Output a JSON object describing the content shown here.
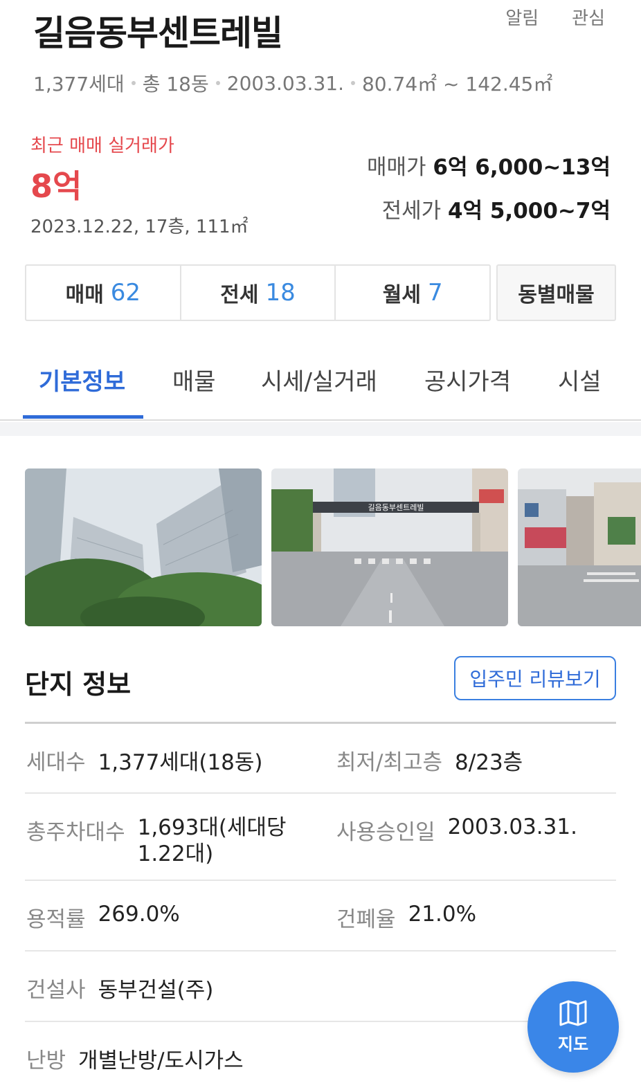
{
  "header": {
    "title": "길음동부센트레빌",
    "actions": [
      "알림",
      "관심"
    ],
    "summary": [
      "1,377세대",
      "총 18동",
      "2003.03.31.",
      "80.74㎡ ~ 142.45㎡"
    ]
  },
  "recent_deal": {
    "label": "최근 매매 실거래가",
    "price": "8억",
    "meta": "2023.12.22, 17층, 111㎡"
  },
  "price_ranges": {
    "sale_label": "매매가",
    "sale_value": "6억 6,000~13억",
    "jeonse_label": "전세가",
    "jeonse_value": "4억 5,000~7억"
  },
  "deal_tabs": [
    {
      "label": "매매",
      "count": "62"
    },
    {
      "label": "전세",
      "count": "18"
    },
    {
      "label": "월세",
      "count": "7"
    }
  ],
  "deal_dong_label": "동별매물",
  "main_tabs": [
    "기본정보",
    "매물",
    "시세/실거래",
    "공시가격",
    "시설"
  ],
  "photos": [
    {
      "icon": "apartment-photo"
    },
    {
      "icon": "gate-photo",
      "sign_text": "길음동부센트레빌"
    },
    {
      "icon": "street-photo"
    }
  ],
  "complex_info": {
    "title": "단지 정보",
    "review_button": "입주민 리뷰보기",
    "rows": {
      "households_label": "세대수",
      "households_value": "1,377세대(18동)",
      "floors_label": "최저/최고층",
      "floors_value": "8/23층",
      "parking_label": "총주차대수",
      "parking_value": "1,693대(세대당 1.22대)",
      "approval_label": "사용승인일",
      "approval_value": "2003.03.31.",
      "far_label": "용적률",
      "far_value": "269.0%",
      "bcr_label": "건폐율",
      "bcr_value": "21.0%",
      "builder_label": "건설사",
      "builder_value": "동부건설(주)",
      "heating_label": "난방",
      "heating_value": "개별난방/도시가스"
    }
  },
  "map_button": {
    "label": "지도",
    "icon": "map-icon"
  },
  "colors": {
    "accent": "#2f6bd8",
    "price_red": "#e5484d",
    "fab_blue": "#3a86e8"
  }
}
